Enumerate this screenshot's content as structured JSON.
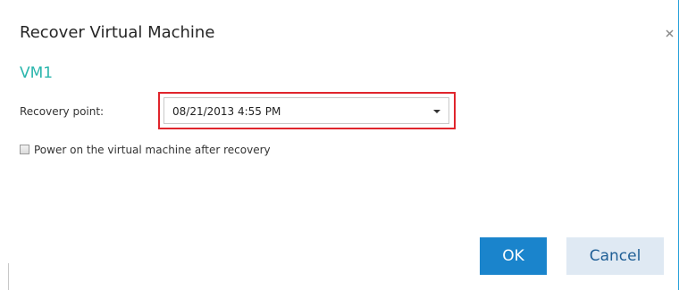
{
  "dialog": {
    "title": "Recover Virtual Machine",
    "close_icon": "close-icon",
    "vm_name": "VM1"
  },
  "recovery_point": {
    "label": "Recovery point:",
    "value": "08/21/2013 4:55 PM",
    "arrow_icon": "dropdown-arrow-icon"
  },
  "power_on": {
    "label": "Power on the virtual machine after recovery",
    "checked": false
  },
  "buttons": {
    "ok": "OK",
    "cancel": "Cancel"
  },
  "colors": {
    "accent": "#2bb6ad",
    "primary_button": "#1a84cc",
    "highlight": "#e0252c"
  }
}
